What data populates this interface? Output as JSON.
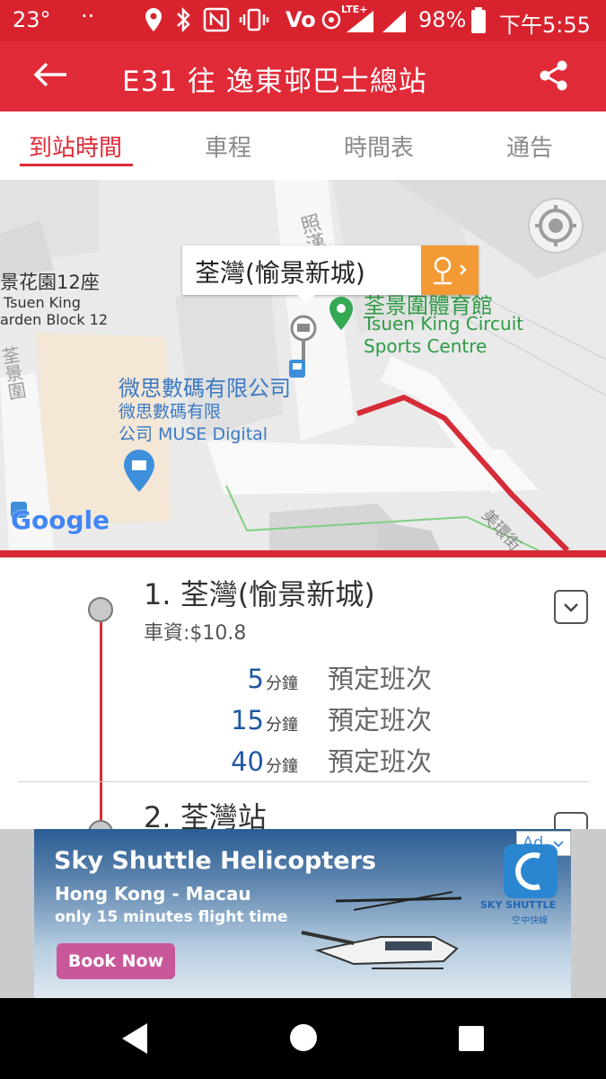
{
  "status_bar": {
    "temperature": "23°",
    "dots": "··",
    "network": "Vo",
    "lte": "LTE+",
    "battery": "98%",
    "time": "下午5:55"
  },
  "app_bar": {
    "title": "E31 往 逸東邨巴士總站"
  },
  "tabs": [
    {
      "label": "到站時間",
      "active": true
    },
    {
      "label": "車程",
      "active": false
    },
    {
      "label": "時間表",
      "active": false
    },
    {
      "label": "通告",
      "active": false
    }
  ],
  "map": {
    "stop_callout": "荃灣(愉景新城)",
    "poi_sports_cn": "荃景圍體育館",
    "poi_sports_en1": "Tsuen King Circuit",
    "poi_sports_en2": "Sports Centre",
    "poi_shop_cn1": "微思數碼有限公司",
    "poi_shop_cn2": "微思數碼有限",
    "poi_shop_en": "公司 MUSE Digital",
    "block_cn": "景花園12座",
    "block_en1": "Tsuen King",
    "block_en2": "arden Block 12",
    "road_top": "照漢",
    "road_left": "荃景圍",
    "road_bottom": "美環街",
    "google": "Google",
    "route_color": "#d52c37"
  },
  "stops": [
    {
      "name": "1. 荃灣(愉景新城)",
      "fare": "車資:$10.8",
      "etas": [
        {
          "minutes": "5",
          "unit": "分鐘",
          "type": "預定班次"
        },
        {
          "minutes": "15",
          "unit": "分鐘",
          "type": "預定班次"
        },
        {
          "minutes": "40",
          "unit": "分鐘",
          "type": "預定班次"
        }
      ]
    },
    {
      "name": "2. 荃灣站"
    }
  ],
  "ad": {
    "headline": "Sky Shuttle Helicopters",
    "line1": "Hong Kong - Macau",
    "line2": "only 15 minutes flight time",
    "cta": "Book Now",
    "badge": "Ad",
    "brand": "SKY SHUTTLE",
    "brand_cn": "空中快線"
  },
  "colors": {
    "accent": "#e12a38",
    "eta_blue": "#1f57a5"
  }
}
